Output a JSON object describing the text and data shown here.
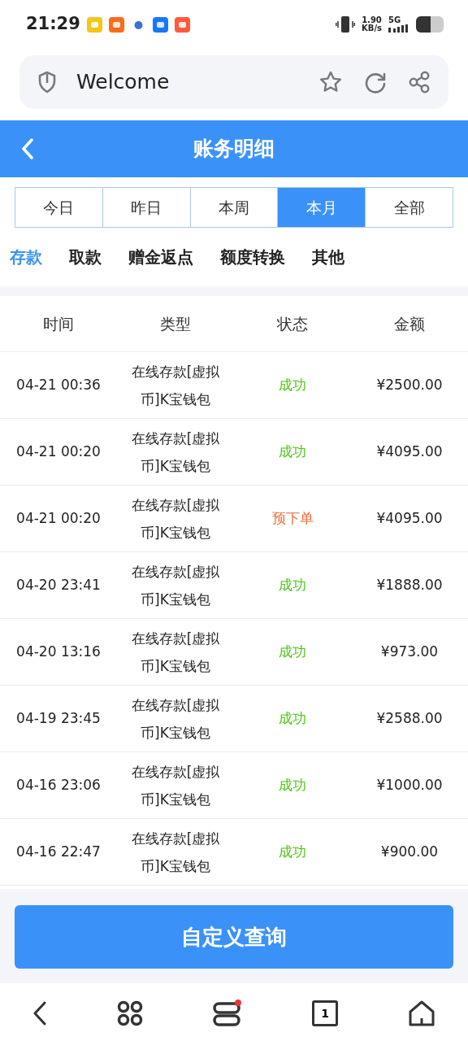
{
  "status_bar": {
    "time": "21:29",
    "network_speed": "1.90",
    "network_unit": "KB/s",
    "network_type": "5G"
  },
  "address_bar": {
    "title": "Welcome"
  },
  "header": {
    "title": "账务明细"
  },
  "period_tabs": [
    {
      "label": "今日",
      "selected": false
    },
    {
      "label": "昨日",
      "selected": false
    },
    {
      "label": "本周",
      "selected": false
    },
    {
      "label": "本月",
      "selected": true
    },
    {
      "label": "全部",
      "selected": false
    }
  ],
  "category_tabs": [
    {
      "label": "存款",
      "selected": true
    },
    {
      "label": "取款",
      "selected": false
    },
    {
      "label": "赠金返点",
      "selected": false
    },
    {
      "label": "额度转换",
      "selected": false
    },
    {
      "label": "其他",
      "selected": false
    }
  ],
  "table": {
    "columns": [
      "时间",
      "类型",
      "状态",
      "金额"
    ],
    "rows": [
      {
        "time": "04-21 00:36",
        "type": "在线存款[虚拟币]K宝钱包",
        "status": "成功",
        "kind": "success",
        "amount": "¥2500.00"
      },
      {
        "time": "04-21 00:20",
        "type": "在线存款[虚拟币]K宝钱包",
        "status": "成功",
        "kind": "success",
        "amount": "¥4095.00"
      },
      {
        "time": "04-21 00:20",
        "type": "在线存款[虚拟币]K宝钱包",
        "status": "预下单",
        "kind": "pending",
        "amount": "¥4095.00"
      },
      {
        "time": "04-20 23:41",
        "type": "在线存款[虚拟币]K宝钱包",
        "status": "成功",
        "kind": "success",
        "amount": "¥1888.00"
      },
      {
        "time": "04-20 13:16",
        "type": "在线存款[虚拟币]K宝钱包",
        "status": "成功",
        "kind": "success",
        "amount": "¥973.00"
      },
      {
        "time": "04-19 23:45",
        "type": "在线存款[虚拟币]K宝钱包",
        "status": "成功",
        "kind": "success",
        "amount": "¥2588.00"
      },
      {
        "time": "04-16 23:06",
        "type": "在线存款[虚拟币]K宝钱包",
        "status": "成功",
        "kind": "success",
        "amount": "¥1000.00"
      },
      {
        "time": "04-16 22:47",
        "type": "在线存款[虚拟币]K宝钱包",
        "status": "成功",
        "kind": "success",
        "amount": "¥900.00"
      }
    ]
  },
  "query_button": {
    "label": "自定义查询"
  },
  "browser_nav": {
    "tab_count": "1",
    "menu_has_notification": true
  }
}
